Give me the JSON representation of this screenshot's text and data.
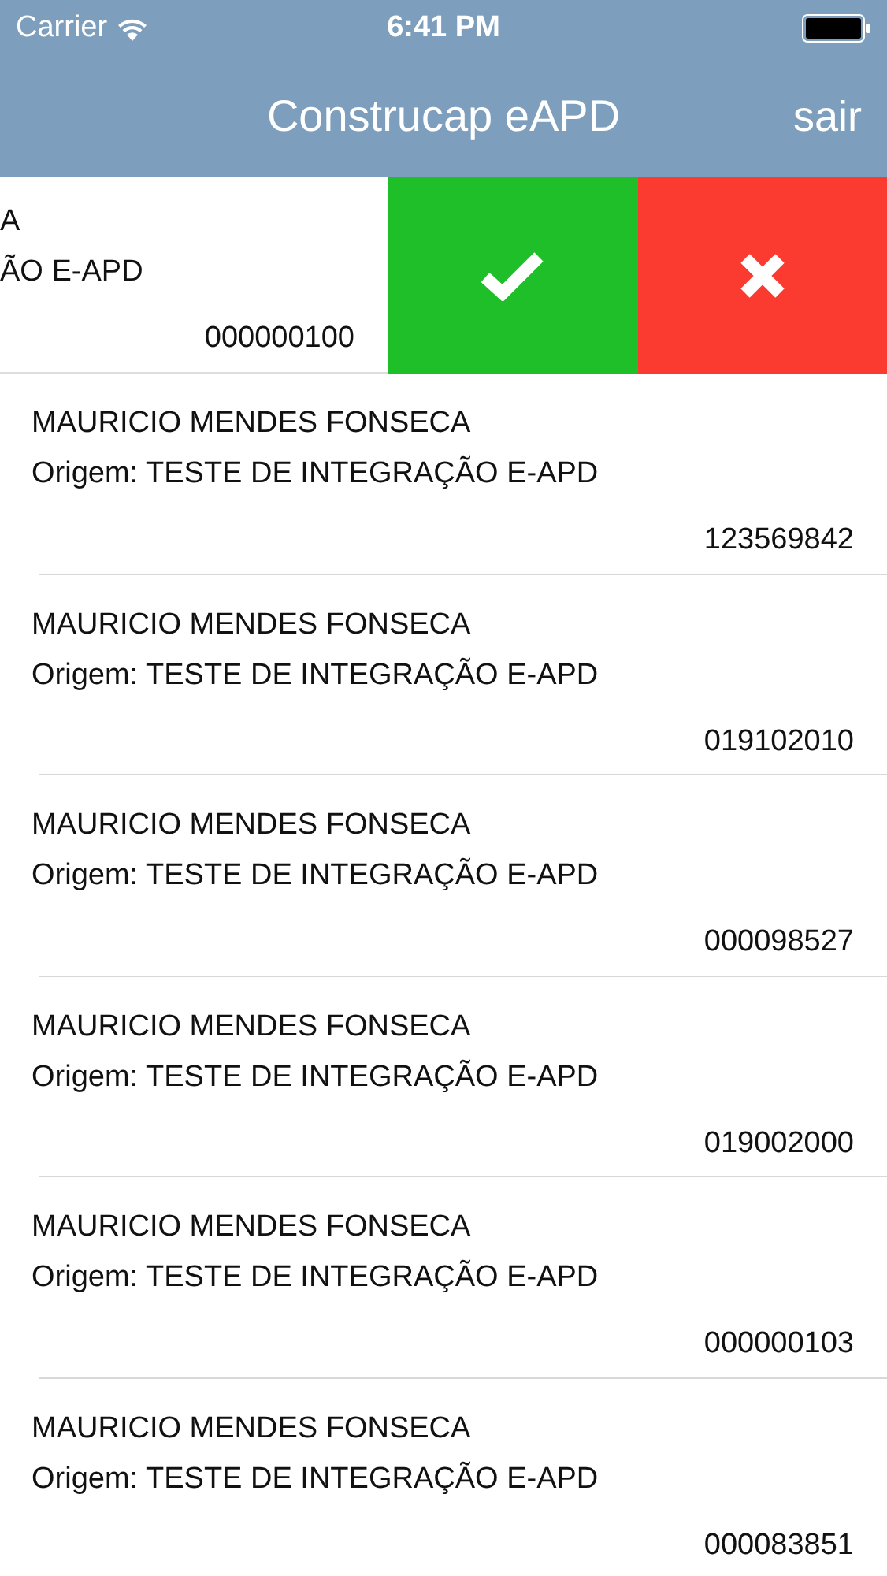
{
  "status_bar": {
    "carrier": "Carrier",
    "time": "6:41 PM"
  },
  "nav_bar": {
    "title": "Construcap eAPD",
    "action": "sair"
  },
  "swiped_row": {
    "name": "A",
    "origin": "ÃO E-APD",
    "number": "000000100"
  },
  "rows": [
    {
      "name": "MAURICIO MENDES FONSECA",
      "origin": "Origem: TESTE DE INTEGRAÇÃO E-APD",
      "number": "123569842"
    },
    {
      "name": "MAURICIO MENDES FONSECA",
      "origin": "Origem: TESTE DE INTEGRAÇÃO E-APD",
      "number": "019102010"
    },
    {
      "name": "MAURICIO MENDES FONSECA",
      "origin": "Origem: TESTE DE INTEGRAÇÃO E-APD",
      "number": "000098527"
    },
    {
      "name": "MAURICIO MENDES FONSECA",
      "origin": "Origem: TESTE DE INTEGRAÇÃO E-APD",
      "number": "019002000"
    },
    {
      "name": "MAURICIO MENDES FONSECA",
      "origin": "Origem: TESTE DE INTEGRAÇÃO E-APD",
      "number": "000000103"
    },
    {
      "name": "MAURICIO MENDES FONSECA",
      "origin": "Origem: TESTE DE INTEGRAÇÃO E-APD",
      "number": "000083851"
    }
  ]
}
